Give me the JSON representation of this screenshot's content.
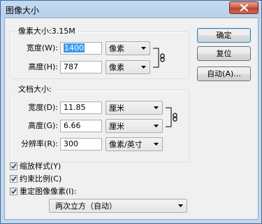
{
  "window": {
    "title": "图像大小"
  },
  "pixel_dimensions": {
    "legend": "像素大小:3.15M",
    "width_label": "宽度(W):",
    "width_value": "1400",
    "width_unit": "像素",
    "height_label": "高度(H):",
    "height_value": "787",
    "height_unit": "像素"
  },
  "document_size": {
    "legend": "文档大小:",
    "width_label": "宽度(D):",
    "width_value": "11.85",
    "width_unit": "厘米",
    "height_label": "高度(G):",
    "height_value": "6.66",
    "height_unit": "厘米",
    "resolution_label": "分辨率(R):",
    "resolution_value": "300",
    "resolution_unit": "像素/英寸"
  },
  "buttons": {
    "ok": "确定",
    "reset": "复位",
    "auto": "自动(A)..."
  },
  "options": {
    "scale_styles": {
      "label": "缩放样式(Y)",
      "checked": true
    },
    "constrain_proportions": {
      "label": "约束比例(C)",
      "checked": true
    },
    "resample": {
      "label": "重定图像像素(I):",
      "checked": true
    },
    "resample_method": "两次立方（自动）"
  },
  "colors": {
    "accent_selection": "#3399ff",
    "close_button": "#c0412a"
  }
}
